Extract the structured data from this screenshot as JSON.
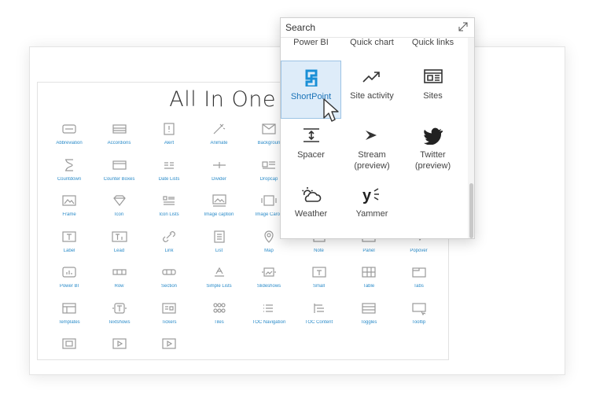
{
  "canvas": {
    "title": "All In One We"
  },
  "grid": {
    "rows": [
      [
        {
          "label": "Abbreviation",
          "icon": "abbreviation-icon"
        },
        {
          "label": "Accordions",
          "icon": "accordions-icon"
        },
        {
          "label": "Alert",
          "icon": "alert-icon"
        },
        {
          "label": "Animate",
          "icon": "animate-icon"
        },
        {
          "label": "Backgroun",
          "icon": "background-icon"
        }
      ],
      [
        {
          "label": "Countdown",
          "icon": "countdown-icon"
        },
        {
          "label": "Counter Boxes",
          "icon": "counter-boxes-icon"
        },
        {
          "label": "Date Lists",
          "icon": "date-lists-icon"
        },
        {
          "label": "Divider",
          "icon": "divider-icon"
        },
        {
          "label": "Dropcap",
          "icon": "dropcap-icon"
        }
      ],
      [
        {
          "label": "Frame",
          "icon": "frame-icon"
        },
        {
          "label": "Icon",
          "icon": "diamond-icon"
        },
        {
          "label": "Icon Lists",
          "icon": "icon-lists-icon"
        },
        {
          "label": "Image caption",
          "icon": "image-caption-icon"
        },
        {
          "label": "Image Carou",
          "icon": "image-carousel-icon"
        }
      ],
      [
        {
          "label": "Label",
          "icon": "label-icon"
        },
        {
          "label": "Lead",
          "icon": "lead-icon"
        },
        {
          "label": "Link",
          "icon": "link-icon"
        },
        {
          "label": "List",
          "icon": "list-icon"
        },
        {
          "label": "Map",
          "icon": "map-icon"
        },
        {
          "label": "Note",
          "icon": "note-icon"
        },
        {
          "label": "Panel",
          "icon": "panel-icon"
        },
        {
          "label": "Popover",
          "icon": "popover-icon"
        }
      ],
      [
        {
          "label": "Power BI",
          "icon": "power-bi-icon"
        },
        {
          "label": "Row",
          "icon": "row-icon"
        },
        {
          "label": "Section",
          "icon": "section-icon"
        },
        {
          "label": "Simple Lists",
          "icon": "simple-lists-icon"
        },
        {
          "label": "Slideshows",
          "icon": "slideshows-icon"
        },
        {
          "label": "Small",
          "icon": "small-icon"
        },
        {
          "label": "Table",
          "icon": "table-icon"
        },
        {
          "label": "Tabs",
          "icon": "tabs-icon"
        }
      ],
      [
        {
          "label": "Templates",
          "icon": "templates-icon"
        },
        {
          "label": "Textshows",
          "icon": "textshows-icon"
        },
        {
          "label": "Tickers",
          "icon": "tickers-icon"
        },
        {
          "label": "Tiles",
          "icon": "tiles-icon"
        },
        {
          "label": "TOC Navigation",
          "icon": "toc-navigation-icon"
        },
        {
          "label": "TOC Content",
          "icon": "toc-content-icon"
        },
        {
          "label": "Toggles",
          "icon": "toggles-icon"
        },
        {
          "label": "Tooltip",
          "icon": "tooltip-icon"
        }
      ],
      [
        {
          "label": "",
          "icon": "video-icon"
        },
        {
          "label": "",
          "icon": "video-play-icon"
        },
        {
          "label": "",
          "icon": "video-player-icon"
        }
      ]
    ]
  },
  "picker": {
    "search_placeholder": "Search",
    "cut_labels": [
      "Power BI",
      "Quick chart",
      "Quick links"
    ],
    "items": [
      {
        "label": "ShortPoint",
        "icon": "shortpoint-icon",
        "selected": true
      },
      {
        "label": "Site activity",
        "icon": "site-activity-icon"
      },
      {
        "label": "Sites",
        "icon": "sites-icon"
      },
      {
        "label": "Spacer",
        "icon": "spacer-icon"
      },
      {
        "label": "Stream\n(preview)",
        "icon": "stream-icon"
      },
      {
        "label": "Twitter\n(preview)",
        "icon": "twitter-icon"
      },
      {
        "label": "Weather",
        "icon": "weather-icon"
      },
      {
        "label": "Yammer",
        "icon": "yammer-icon"
      }
    ]
  }
}
